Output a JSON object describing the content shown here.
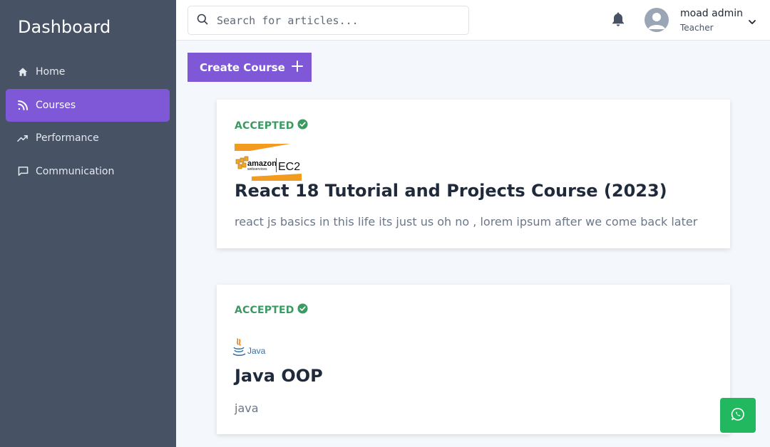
{
  "sidebar": {
    "brand": "Dashboard",
    "items": [
      {
        "label": "Home",
        "icon": "home-icon",
        "active": false
      },
      {
        "label": "Courses",
        "icon": "rss-icon",
        "active": true
      },
      {
        "label": "Performance",
        "icon": "trend-up-icon",
        "active": false
      },
      {
        "label": "Communication",
        "icon": "chat-icon",
        "active": false
      }
    ]
  },
  "header": {
    "search": {
      "placeholder": "Search for articles...",
      "value": ""
    },
    "user": {
      "name": "moad admin",
      "role": "Teacher"
    }
  },
  "main": {
    "create_label": "Create Course",
    "courses": [
      {
        "status": "ACCEPTED",
        "logo": {
          "text_top": "amazon",
          "text_sub": "webservices",
          "text_right": "EC2"
        },
        "title": "React 18 Tutorial and Projects Course (2023)",
        "description": "react js basics in this life its just us oh no , lorem ipsum after we come back later"
      },
      {
        "status": "ACCEPTED",
        "logo": {
          "text": "Java"
        },
        "title": "Java OOP",
        "description": "java"
      }
    ]
  },
  "colors": {
    "sidebar_bg": "#475264",
    "accent": "#7e58d6",
    "accepted": "#3b9a62",
    "fab": "#22b85f"
  }
}
